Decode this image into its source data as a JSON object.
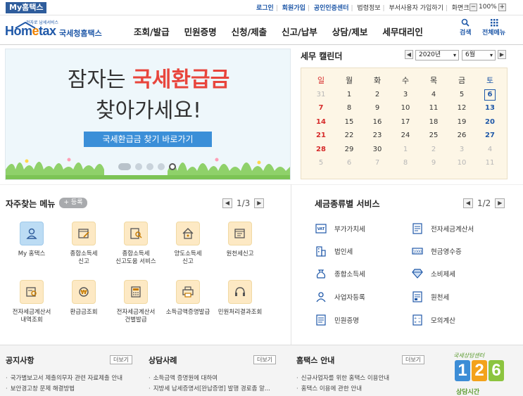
{
  "topbar": {
    "my_badge": "My홈택스",
    "links": [
      "로그인",
      "회원가입",
      "공인인증센터",
      "법령정보",
      "부서사용자 가입하기",
      "화면크기"
    ],
    "zoom_minus": "−",
    "zoom_value": "100%",
    "zoom_plus": "+"
  },
  "header": {
    "logo_small": "전자로 납세서비스",
    "logo_home": "Hom",
    "logo_e": "e",
    "logo_tax": "tax",
    "logo_side": "국세청홈택스",
    "nav": [
      "조회/발급",
      "민원증명",
      "신청/제출",
      "신고/납부",
      "상담/제보",
      "세무대리인"
    ],
    "search_label": "검색",
    "allmenu_label": "전체메뉴"
  },
  "banner": {
    "line1_pre": "잠자는 ",
    "line1_red": "국세환급금",
    "line2": "찾아가세요!",
    "cta": "국세환급금 찾기 바로가기"
  },
  "calendar": {
    "title": "세무 캘린더",
    "year": "2020년",
    "month": "6월",
    "weekdays": [
      "일",
      "월",
      "화",
      "수",
      "목",
      "금",
      "토"
    ],
    "weeks": [
      [
        "31",
        "1",
        "2",
        "3",
        "4",
        "5",
        "6"
      ],
      [
        "7",
        "8",
        "9",
        "10",
        "11",
        "12",
        "13"
      ],
      [
        "14",
        "15",
        "16",
        "17",
        "18",
        "19",
        "20"
      ],
      [
        "21",
        "22",
        "23",
        "24",
        "25",
        "26",
        "27"
      ],
      [
        "28",
        "29",
        "30",
        "1",
        "2",
        "3",
        "4"
      ],
      [
        "5",
        "6",
        "7",
        "8",
        "9",
        "10",
        "11"
      ]
    ],
    "today": "6"
  },
  "favorites": {
    "title": "자주찾는 메뉴",
    "add_label": "+ 등록",
    "page": "1/3",
    "items": [
      {
        "line1": "My 홈택스",
        "line2": ""
      },
      {
        "line1": "종합소득세",
        "line2": "신고"
      },
      {
        "line1": "종합소득세",
        "line2": "신고도움 서비스"
      },
      {
        "line1": "양도소득세",
        "line2": "신고"
      },
      {
        "line1": "원천세신고",
        "line2": ""
      },
      {
        "line1": "전자세금계산서",
        "line2": "내역조회"
      },
      {
        "line1": "환급금조회",
        "line2": ""
      },
      {
        "line1": "전자세금계산서",
        "line2": "건별발급"
      },
      {
        "line1": "소득금액증명발급",
        "line2": ""
      },
      {
        "line1": "민원처리결과조회",
        "line2": ""
      }
    ]
  },
  "taxtypes": {
    "title": "세금종류별 서비스",
    "page": "1/2",
    "items": [
      "부가가치세",
      "전자세금계산서",
      "법인세",
      "현금영수증",
      "종합소득세",
      "소비제세",
      "사업자등록",
      "원천세",
      "민원증명",
      "모의계산"
    ]
  },
  "footer": {
    "more": "더보기",
    "notice": {
      "title": "공지사항",
      "items": [
        "국가별보고서 제출의무자 관련 자료제출 안내",
        "보안경고창 문제 해결방법"
      ]
    },
    "counsel": {
      "title": "상담사례",
      "items": [
        "소득금액 증명원에 대하여",
        "지방세 납세증명서[완납증명] 발행 경로좀 알..."
      ]
    },
    "guide": {
      "title": "홈택스 안내",
      "items": [
        "신규사업자를 위한 홈택스 이용안내",
        "홈택스 이용에 관한 안내"
      ]
    },
    "center": {
      "top": "국세상담센터",
      "d1": "1",
      "d2": "2",
      "d3": "6",
      "bottom": "상담시간"
    }
  },
  "colors": {
    "brand_blue": "#1f58a8",
    "accent_red": "#e8453c",
    "cta_blue": "#3b8fd8",
    "calendar_bg": "#fdf6e6"
  }
}
